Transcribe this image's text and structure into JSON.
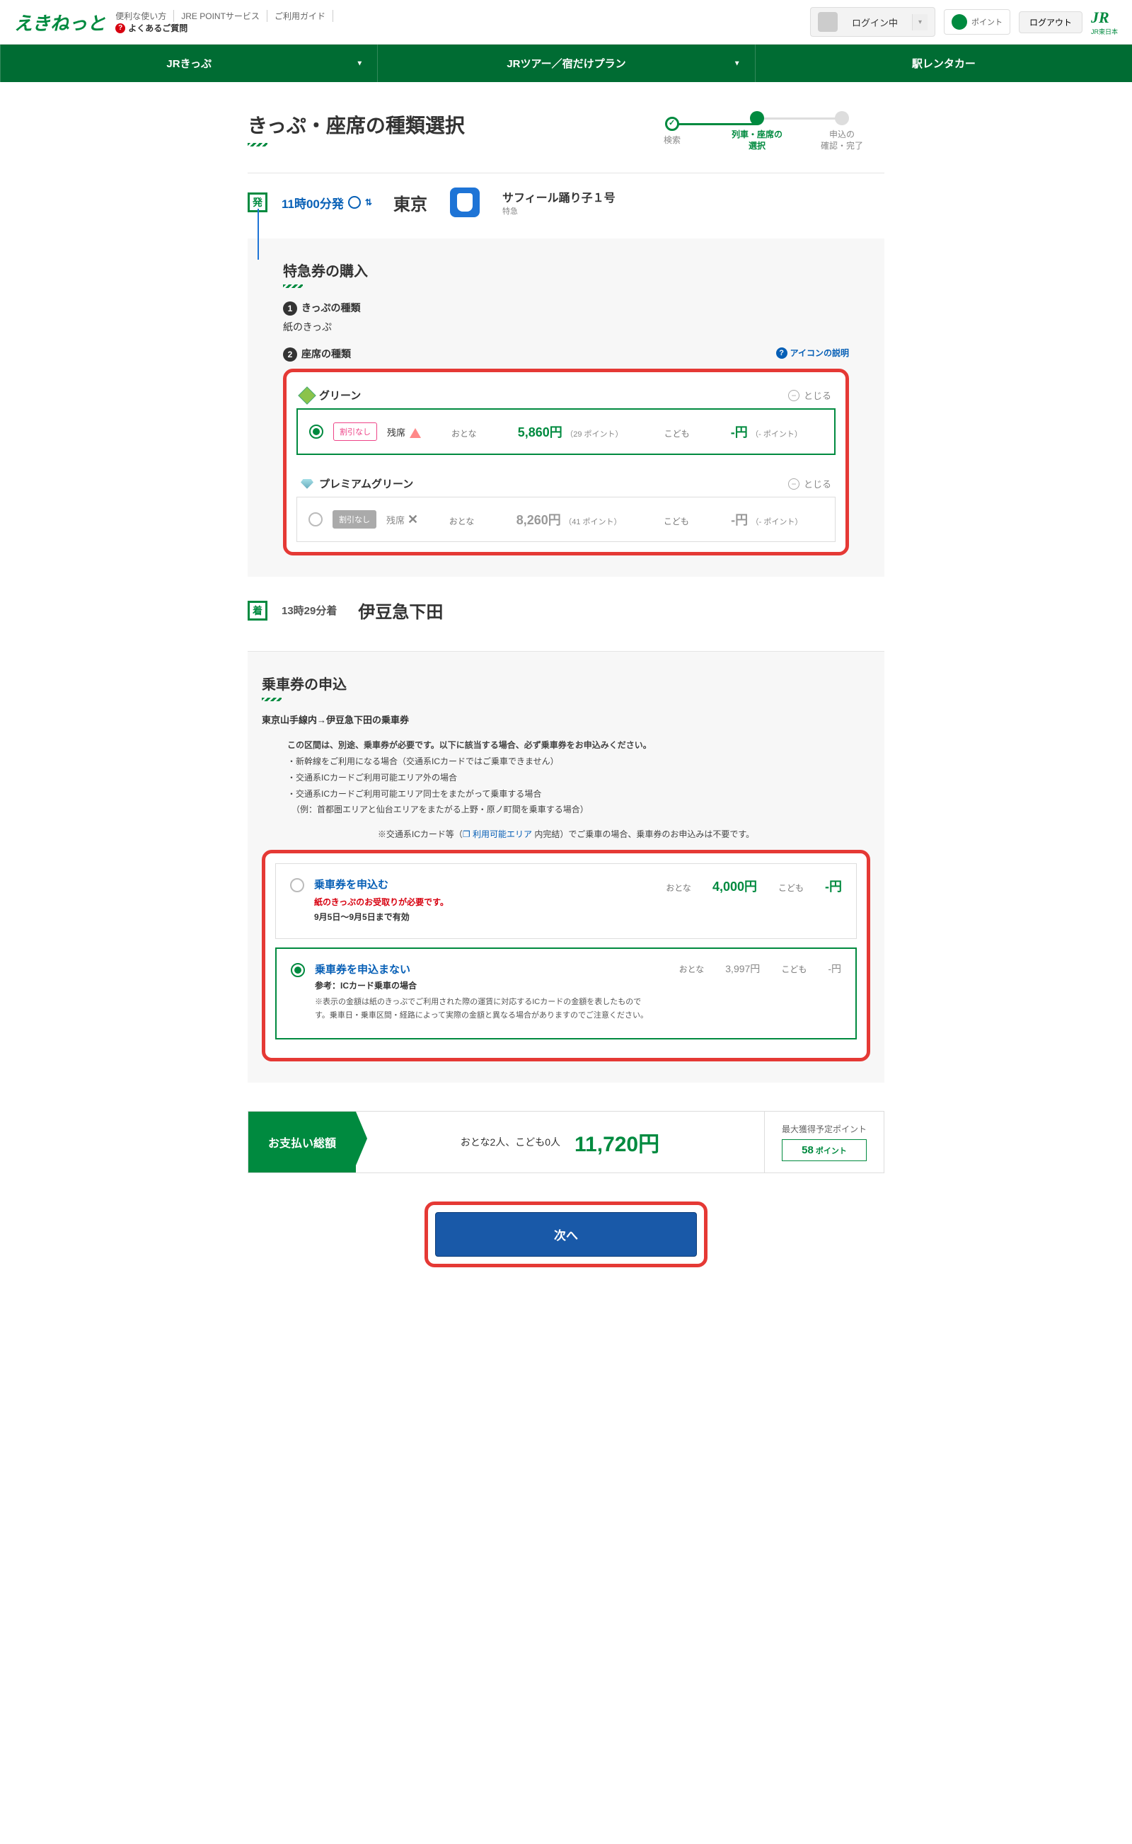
{
  "header": {
    "logo": "えきねっと",
    "links": {
      "l1": "便利な使い方",
      "l2": "JRE POINTサービス",
      "l3": "ご利用ガイド"
    },
    "faq": "よくあるご質問",
    "login_status": "ログイン中",
    "points_label": "ポイント",
    "logout": "ログアウト",
    "jr_brand": "JR",
    "jr_sub": "JR東日本"
  },
  "nav": {
    "n1": "JRきっぷ",
    "n2": "JRツアー／宿だけプラン",
    "n3": "駅レンタカー"
  },
  "page_title": "きっぷ・座席の種類選択",
  "progress": {
    "s1": "検索",
    "s2": "列車・座席の\n選択",
    "s3": "申込の\n確認・完了"
  },
  "trip": {
    "dep_marker": "発",
    "dep_time": "11時00分発",
    "dep_station": "東京",
    "train_name": "サフィール踊り子１号",
    "train_type": "特急",
    "arr_marker": "着",
    "arr_time": "13時29分着",
    "arr_station": "伊豆急下田"
  },
  "express": {
    "section_title": "特急券の購入",
    "sub1": "きっぷの種類",
    "ticket_kind": "紙のきっぷ",
    "sub2": "座席の種類",
    "icon_help": "アイコンの説明"
  },
  "seats": {
    "green": {
      "name": "グリーン",
      "close": "とじる",
      "discount": "割引なし",
      "avail_label": "残席",
      "adult_label": "おとな",
      "adult_price": "5,860円",
      "adult_points": "（29 ポイント）",
      "child_label": "こども",
      "child_price": "-円",
      "child_points": "（- ポイント）"
    },
    "premium": {
      "name": "プレミアムグリーン",
      "close": "とじる",
      "discount": "割引なし",
      "avail_label": "残席",
      "adult_label": "おとな",
      "adult_price": "8,260円",
      "adult_points": "（41 ポイント）",
      "child_label": "こども",
      "child_price": "-円",
      "child_points": "（- ポイント）"
    }
  },
  "baseticket": {
    "section_title": "乗車券の申込",
    "route": "東京山手線内→伊豆急下田の乗車券",
    "lead": "この区間は、別途、乗車券が必要です。以下に該当する場合、必ず乗車券をお申込みください。",
    "b1": "・新幹線をご利用になる場合（交通系ICカードではご乗車できません）",
    "b2": "・交通系ICカードご利用可能エリア外の場合",
    "b3": "・交通系ICカードご利用可能エリア同士をまたがって乗車する場合",
    "b4": "　（例：首都圏エリアと仙台エリアをまたがる上野・原ノ町間を乗車する場合）",
    "icnote_a": "※交通系ICカード等（",
    "icnote_link": "❐ 利用可能エリア",
    "icnote_b": " 内完結）でご乗車の場合、乗車券のお申込みは不要です。",
    "opt_apply": {
      "title": "乗車券を申込む",
      "warn": "紙のきっぷのお受取りが必要です。",
      "valid": "9月5日～9月5日まで有効",
      "adult_label": "おとな",
      "adult_price": "4,000円",
      "child_label": "こども",
      "child_price": "-円"
    },
    "opt_noapply": {
      "title": "乗車券を申込まない",
      "ref": "参考：ICカード乗車の場合",
      "note": "※表示の金額は紙のきっぷでご利用された際の運賃に対応するICカードの金額を表したものです。乗車日・乗車区間・経路によって実際の金額と異なる場合がありますのでご注意ください。",
      "adult_label": "おとな",
      "adult_price": "3,997円",
      "child_label": "こども",
      "child_price": "-円"
    }
  },
  "total": {
    "label": "お支払い総額",
    "count": "おとな2人、こども0人",
    "price": "11,720円",
    "pts_label": "最大獲得予定ポイント",
    "pts_value": "58",
    "pts_unit": " ポイント"
  },
  "next_btn": "次へ"
}
